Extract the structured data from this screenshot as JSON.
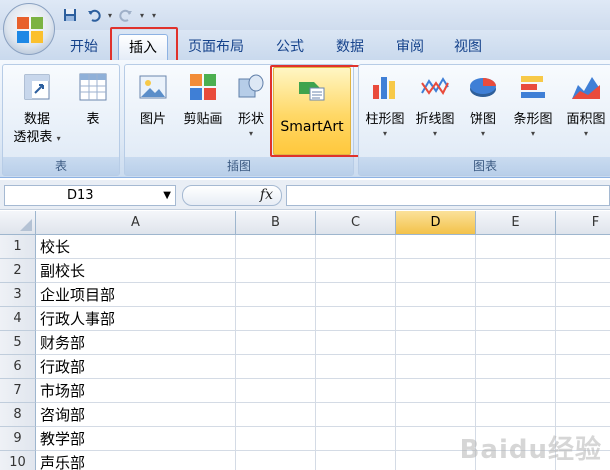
{
  "qat": {
    "save": "save-icon",
    "undo": "undo-icon",
    "redo": "redo-icon"
  },
  "tabs": [
    {
      "label": "开始"
    },
    {
      "label": "插入"
    },
    {
      "label": "页面布局"
    },
    {
      "label": "公式"
    },
    {
      "label": "数据"
    },
    {
      "label": "审阅"
    },
    {
      "label": "视图"
    }
  ],
  "ribbon": {
    "table_group": {
      "label": "表",
      "pivot_line1": "数据",
      "pivot_line2": "透视表",
      "table": "表"
    },
    "illustrations_group": {
      "label": "插图",
      "picture": "图片",
      "clipart": "剪贴画",
      "shapes": "形状",
      "smartart": "SmartArt"
    },
    "charts_group": {
      "label": "图表",
      "column": "柱形图",
      "line": "折线图",
      "pie": "饼图",
      "bar": "条形图",
      "area": "面积图"
    }
  },
  "formula": {
    "namebox": "D13",
    "fx": "fx",
    "value": ""
  },
  "columns": [
    "A",
    "B",
    "C",
    "D",
    "E",
    "F"
  ],
  "rows": [
    {
      "num": "1",
      "a": "校长"
    },
    {
      "num": "2",
      "a": "副校长"
    },
    {
      "num": "3",
      "a": "企业项目部"
    },
    {
      "num": "4",
      "a": "行政人事部"
    },
    {
      "num": "5",
      "a": "财务部"
    },
    {
      "num": "6",
      "a": "行政部"
    },
    {
      "num": "7",
      "a": "市场部"
    },
    {
      "num": "8",
      "a": "咨询部"
    },
    {
      "num": "9",
      "a": "教学部"
    },
    {
      "num": "10",
      "a": "声乐部"
    }
  ],
  "watermark": "Baidu经验",
  "colors": {
    "accent_red": "#e0322c",
    "selected_col": "#f3c24a",
    "ribbon_text": "#15428b"
  }
}
